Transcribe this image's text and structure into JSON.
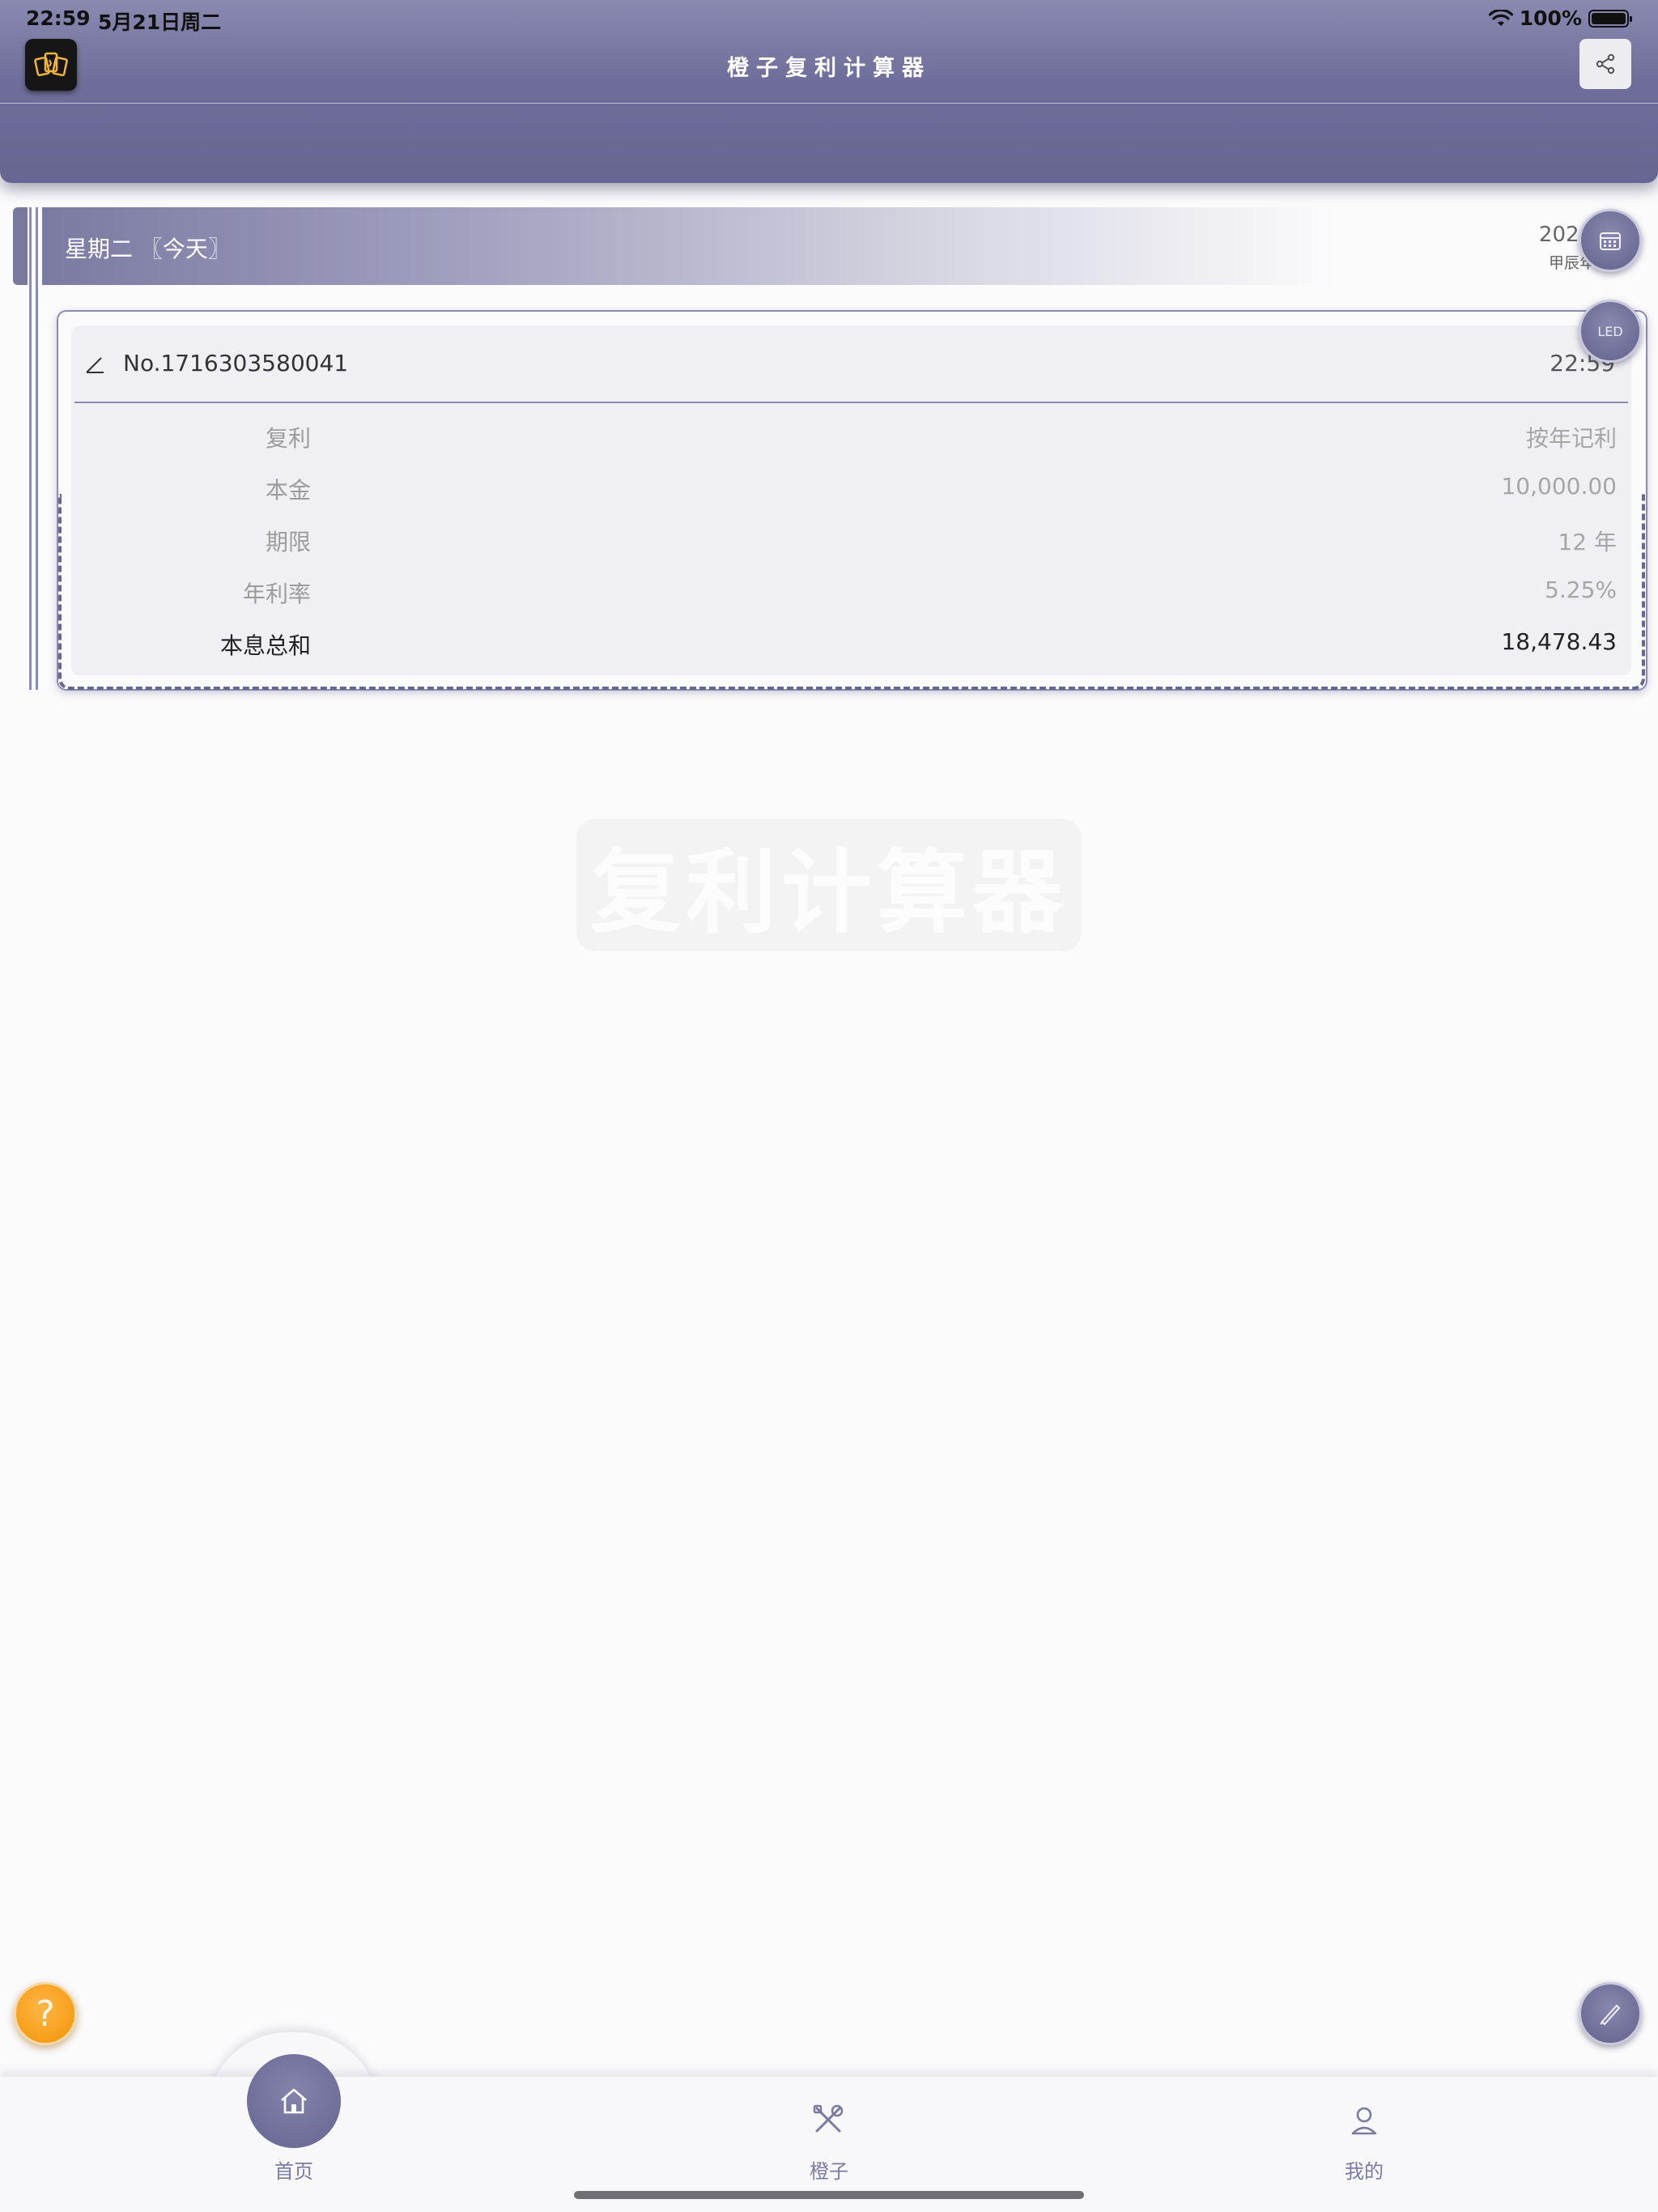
{
  "status_bar": {
    "time": "22:59",
    "date": "5月21日周二",
    "battery": "100%"
  },
  "header": {
    "title": "橙子复利计算器"
  },
  "day": {
    "label": "星期二 〖今天〗",
    "date": "2024-0",
    "lunar": "甲辰年四月"
  },
  "fabs": {
    "led_label": "LED"
  },
  "record": {
    "number": "No.1716303580041",
    "time": "22:59",
    "rows": [
      {
        "label": "复利",
        "value": "按年记利"
      },
      {
        "label": "本金",
        "value": "10,000.00"
      },
      {
        "label": "期限",
        "value": "12 年"
      },
      {
        "label": "年利率",
        "value": "5.25%"
      },
      {
        "label": "本息总和",
        "value": "18,478.43"
      }
    ]
  },
  "watermark": "复利计算器",
  "help_symbol": "?",
  "tabs": [
    {
      "label": "首页",
      "icon": "home-icon"
    },
    {
      "label": "橙子",
      "icon": "tools-icon"
    },
    {
      "label": "我的",
      "icon": "user-icon"
    }
  ],
  "colors": {
    "brand": "#6f6e9a",
    "accent_orange": "#f59a12"
  }
}
